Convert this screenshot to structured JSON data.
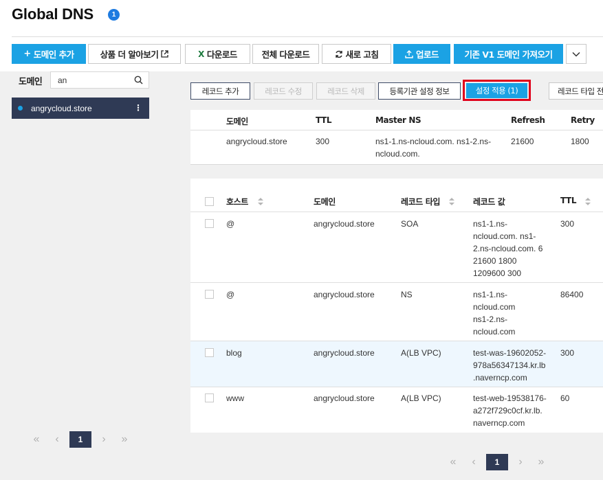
{
  "header": {
    "title": "Global DNS",
    "badge": "1"
  },
  "toolbar": {
    "add_domain": "도메인 추가",
    "learn_more": "상품 더 알아보기",
    "download": "다운로드",
    "download_all": "전체 다운로드",
    "refresh": "새로 고침",
    "upload": "업로드",
    "import_v1": "기존 V1 도메인 가져오기"
  },
  "sidebar": {
    "label": "도메인",
    "search": {
      "value": "an",
      "placeholder": ""
    },
    "items": [
      {
        "name": "angrycloud.store"
      }
    ],
    "pager": {
      "current": "1"
    }
  },
  "record_toolbar": {
    "add": "레코드 추가",
    "edit": "레코드 수정",
    "delete": "레코드 삭제",
    "registrar": "등록기관 설정 정보",
    "apply": "설정 적용 (1)",
    "type_filter": "레코드 타입 전"
  },
  "soa_table": {
    "headers": [
      "도메인",
      "TTL",
      "Master NS",
      "Refresh",
      "Retry"
    ],
    "row": {
      "domain": "angrycloud.store",
      "ttl": "300",
      "master_ns_1": "ns1-1.ns-ncloud.com. ns1-2.ns-",
      "master_ns_2": "ncloud.com.",
      "refresh": "21600",
      "retry": "1800"
    }
  },
  "records_table": {
    "headers": [
      "호스트",
      "도메인",
      "레코드 타입",
      "레코드 값",
      "TTL"
    ],
    "rows": [
      {
        "host": "@",
        "domain": "angrycloud.store",
        "type": "SOA",
        "value_lines": [
          "ns1-1.ns-",
          "ncloud.com. ns1-",
          "2.ns-ncloud.com. 6",
          "21600 1800",
          "1209600 300"
        ],
        "ttl": "300"
      },
      {
        "host": "@",
        "domain": "angrycloud.store",
        "type": "NS",
        "value_lines": [
          "ns1-1.ns-",
          "ncloud.com",
          "ns1-2.ns-",
          "ncloud.com"
        ],
        "ttl": "86400"
      },
      {
        "host": "blog",
        "domain": "angrycloud.store",
        "type": "A(LB VPC)",
        "value_lines": [
          "test-was-19602052-",
          "978a56347134.kr.lb",
          ".naverncp.com"
        ],
        "ttl": "300"
      },
      {
        "host": "www",
        "domain": "angrycloud.store",
        "type": "A(LB VPC)",
        "value_lines": [
          "test-web-19538176-",
          "a272f729c0cf.kr.lb.",
          "naverncp.com"
        ],
        "ttl": "60"
      }
    ],
    "pager": {
      "current": "1"
    }
  },
  "colors": {
    "accent": "#1ba2e4",
    "navy": "#2f3a55",
    "highlight": "#e0001a"
  }
}
